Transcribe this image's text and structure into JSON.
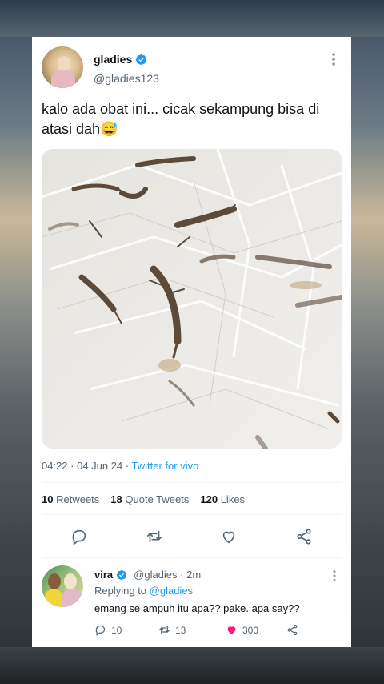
{
  "tweet": {
    "author_name": "gladies",
    "author_handle": "@gladies123",
    "text": "kalo ada obat ini... cicak sekampung bisa di atasi dah😅",
    "time": "04:22 · 04 Jun 24 · ",
    "source": "Twitter for vivo",
    "stats": {
      "retweets_count": "10",
      "retweets_label": "Retweets",
      "quotes_count": "18",
      "quotes_label": "Quote Tweets",
      "likes_count": "120",
      "likes_label": "Likes"
    }
  },
  "reply": {
    "author_name": "vira",
    "author_handle": "@gladies · 2m",
    "replying_prefix": "Replying to ",
    "replying_mention": "@gladies",
    "text": "emang se ampuh itu apa?? pake. apa say??",
    "replies": "10",
    "retweets": "13",
    "likes": "300"
  },
  "colors": {
    "accent": "#1d9bf0",
    "like_active": "#f91880",
    "text_primary": "#0f1419",
    "text_secondary": "#536471"
  },
  "icons": [
    "verified-badge-icon",
    "more-icon",
    "reply-icon",
    "retweet-icon",
    "like-icon",
    "share-icon"
  ]
}
